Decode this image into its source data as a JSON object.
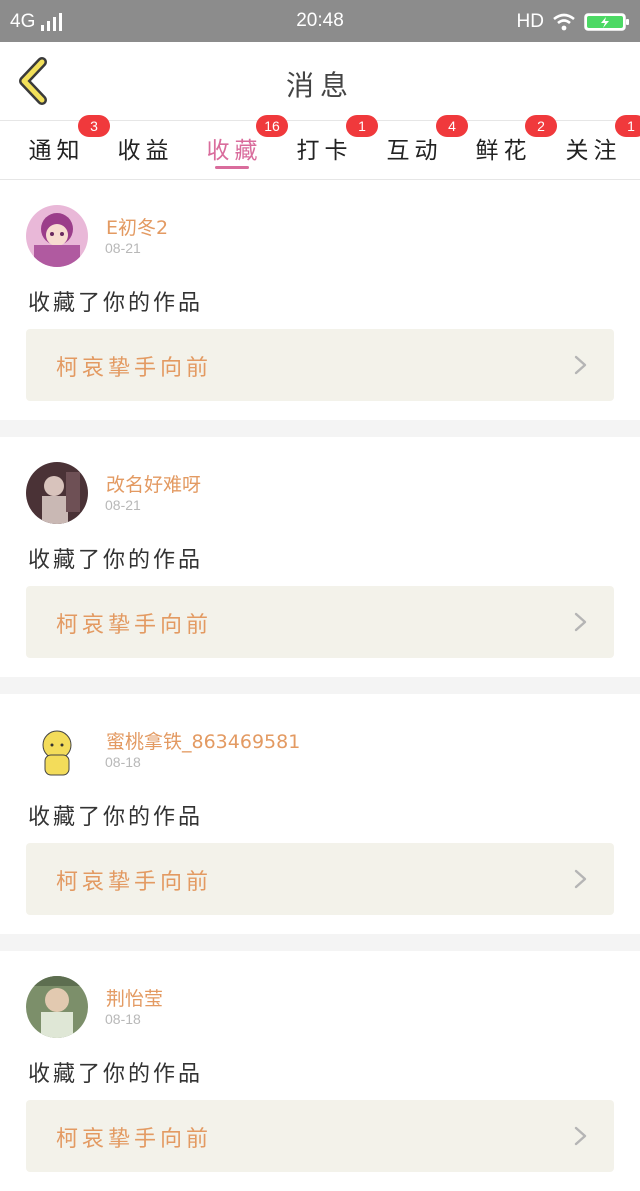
{
  "status_bar": {
    "network": "4G",
    "time": "20:48",
    "hd": "HD"
  },
  "header": {
    "title": "消息"
  },
  "tabs": [
    {
      "label": "通知",
      "badge": "3",
      "active": false
    },
    {
      "label": "收益",
      "badge": "",
      "active": false
    },
    {
      "label": "收藏",
      "badge": "16",
      "active": true
    },
    {
      "label": "打卡",
      "badge": "1",
      "active": false
    },
    {
      "label": "互动",
      "badge": "4",
      "active": false
    },
    {
      "label": "鲜花",
      "badge": "2",
      "active": false
    },
    {
      "label": "关注",
      "badge": "1",
      "active": false
    }
  ],
  "messages": [
    {
      "username": "E初冬2",
      "date": "08-21",
      "action": "收藏了你的作品",
      "work_title": "柯哀挚手向前"
    },
    {
      "username": "改名好难呀",
      "date": "08-21",
      "action": "收藏了你的作品",
      "work_title": "柯哀挚手向前"
    },
    {
      "username": "蜜桃拿铁_863469581",
      "date": "08-18",
      "action": "收藏了你的作品",
      "work_title": "柯哀挚手向前"
    },
    {
      "username": "荆怡莹",
      "date": "08-18",
      "action": "收藏了你的作品",
      "work_title": "柯哀挚手向前"
    }
  ],
  "colors": {
    "accent": "#d96c9c",
    "username": "#e39a62",
    "badge": "#f0393c",
    "link_bg": "#f3f2ea"
  }
}
